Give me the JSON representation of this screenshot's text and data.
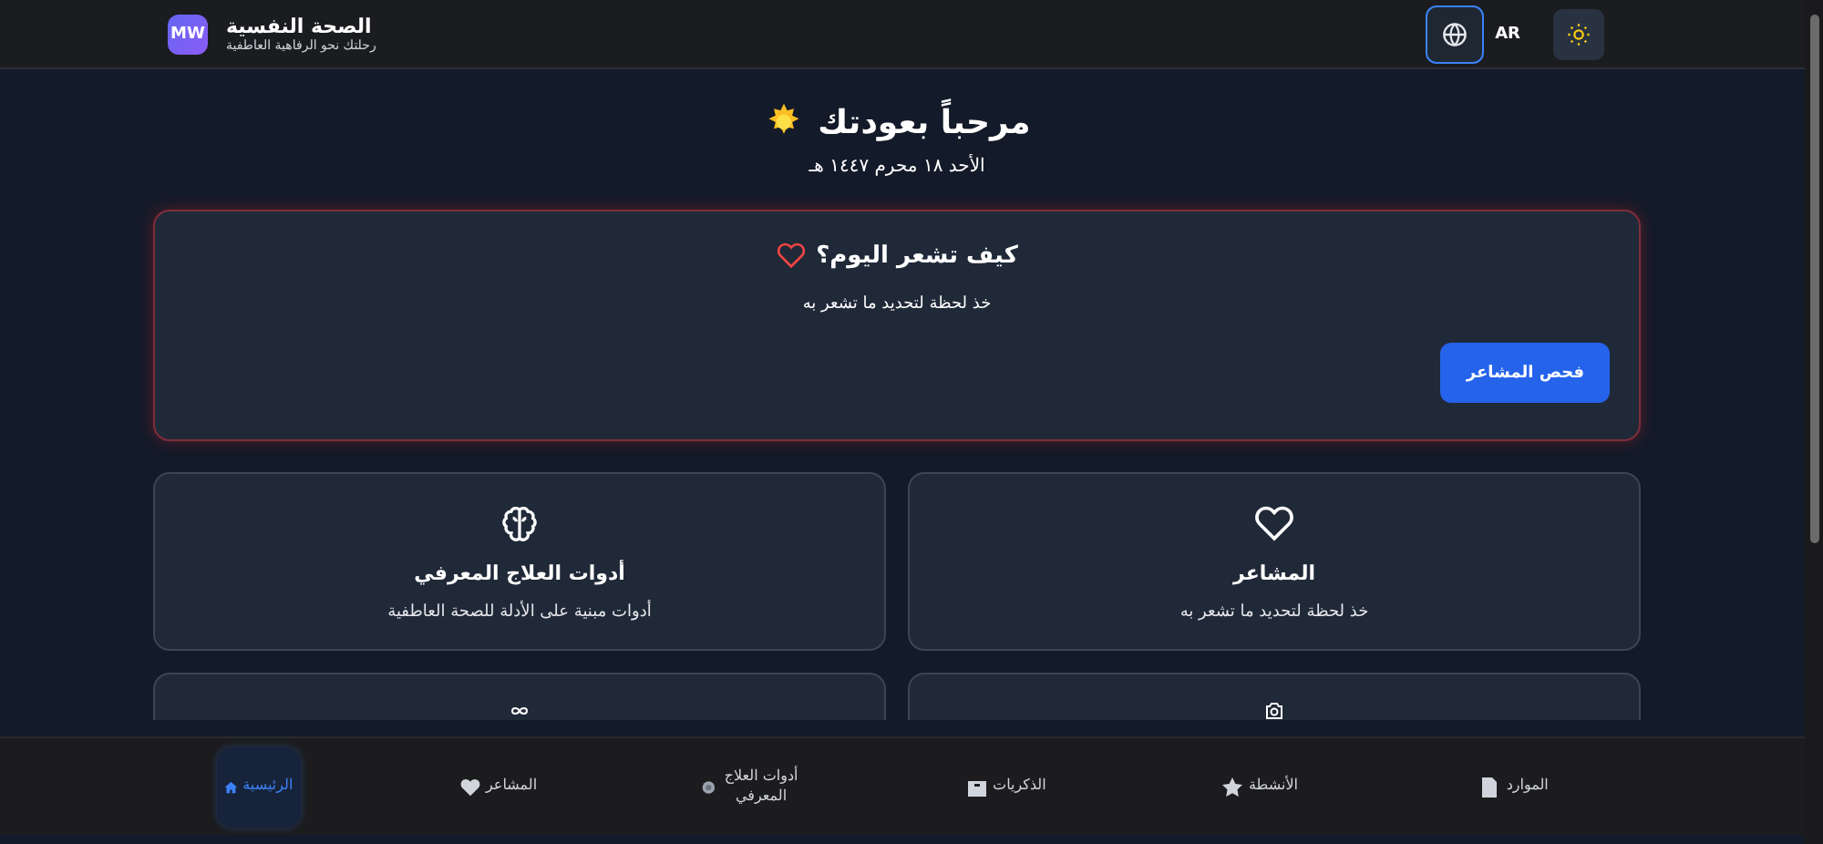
{
  "header": {
    "logo": "MW",
    "title": "الصحة النفسية",
    "subtitle": "رحلتك نحو الرفاهية العاطفية",
    "language": "AR"
  },
  "welcome": {
    "title": "مرحباً بعودتك",
    "date": "الأحد ١٨ محرم ١٤٤٧ هـ"
  },
  "mood_card": {
    "title": "كيف تشعر اليوم؟",
    "text": "خذ لحظة لتحديد ما تشعر به",
    "button": "فحص المشاعر"
  },
  "features": [
    {
      "kind": "heart",
      "title": "المشاعر",
      "description": "خذ لحظة لتحديد ما تشعر به"
    },
    {
      "kind": "brain",
      "title": "أدوات العلاج المعرفي",
      "description": "أدوات مبنية على الأدلة للصحة العاطفية"
    },
    {
      "kind": "camera"
    },
    {
      "kind": "knot"
    }
  ],
  "bottom_nav": [
    {
      "kind": "doc",
      "label": "الموارد",
      "selected": false
    },
    {
      "kind": "star",
      "label": "الأنشطة",
      "selected": false
    },
    {
      "kind": "box",
      "label": "الذكريات",
      "selected": false
    },
    {
      "kind": "circle",
      "label": "أدوات العلاج المعرفي",
      "selected": false
    },
    {
      "kind": "heart",
      "label": "المشاعر",
      "selected": false
    },
    {
      "kind": "home",
      "label": "الرئيسية",
      "selected": true
    }
  ]
}
